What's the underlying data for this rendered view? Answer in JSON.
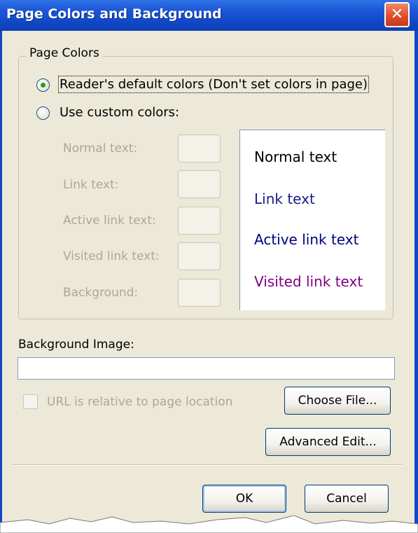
{
  "window": {
    "title": "Page Colors and Background",
    "close_glyph": "✕"
  },
  "page_colors": {
    "legend": "Page Colors",
    "radio_default": {
      "label": "Reader's default colors (Don't set colors in page)",
      "selected": true
    },
    "radio_custom": {
      "label": "Use custom colors:",
      "selected": false
    },
    "color_labels": [
      "Normal text:",
      "Link text:",
      "Active link text:",
      "Visited link text:",
      "Background:"
    ],
    "preview": {
      "normal": "Normal text",
      "link": "Link text",
      "active": "Active link text",
      "visited": "Visited link text"
    },
    "colors": {
      "normal": "#000000",
      "link": "#1a1a8c",
      "active": "#000080",
      "visited": "#800080",
      "background": "#ffffff"
    }
  },
  "background_image": {
    "label": "Background Image:",
    "value": "",
    "relative_label": "URL is relative to page location",
    "relative_checked": false
  },
  "buttons": {
    "choose_file": "Choose File...",
    "advanced_edit": "Advanced Edit...",
    "ok": "OK",
    "cancel": "Cancel"
  }
}
